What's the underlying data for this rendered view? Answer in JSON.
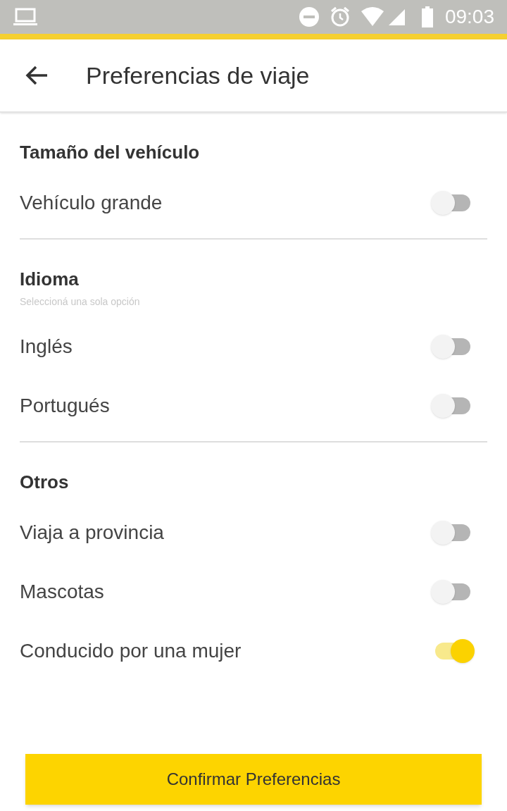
{
  "status_bar": {
    "time": "09:03"
  },
  "app_bar": {
    "title": "Preferencias de viaje"
  },
  "sections": [
    {
      "title": "Tamaño del vehículo",
      "rows": [
        {
          "label": "Vehículo grande",
          "on": false
        }
      ]
    },
    {
      "title": "Idioma",
      "subtitle": "Seleccioná una sola opción",
      "rows": [
        {
          "label": "Inglés",
          "on": false
        },
        {
          "label": "Portugués",
          "on": false
        }
      ]
    },
    {
      "title": "Otros",
      "rows": [
        {
          "label": "Viaja a provincia",
          "on": false
        },
        {
          "label": "Mascotas",
          "on": false
        },
        {
          "label": "Conducido por una mujer",
          "on": true
        }
      ]
    }
  ],
  "confirm_button": "Confirmar Preferencias"
}
